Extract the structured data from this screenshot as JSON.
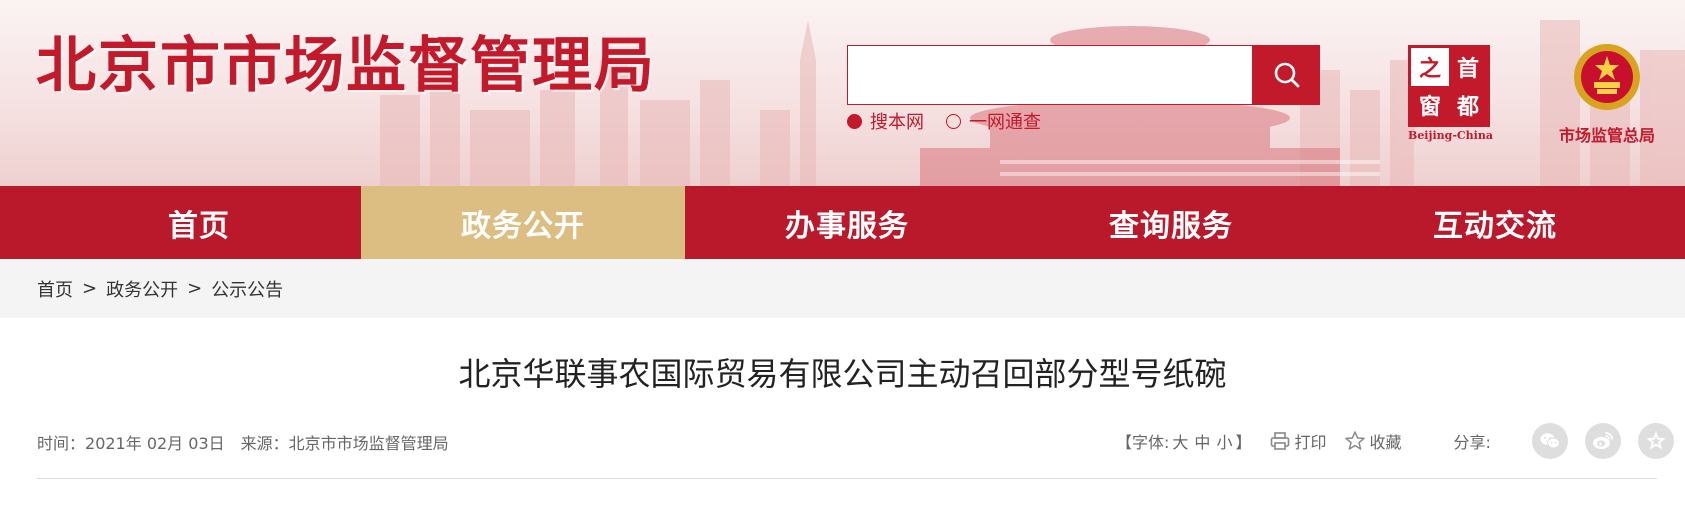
{
  "header": {
    "site_title": "北京市市场监督管理局",
    "search": {
      "placeholder": "",
      "options": [
        {
          "label": "搜本网",
          "selected": true
        },
        {
          "label": "一网通查",
          "selected": false
        }
      ],
      "button_icon": "search-icon"
    },
    "capital_logo": {
      "chars": [
        "之",
        "首",
        "窗",
        "都"
      ],
      "caption": "Beijing-China"
    },
    "samr_logo": {
      "icon": "national-emblem-icon",
      "caption": "市场监管总局"
    }
  },
  "nav": {
    "items": [
      {
        "label": "首页",
        "active": false
      },
      {
        "label": "政务公开",
        "active": true
      },
      {
        "label": "办事服务",
        "active": false
      },
      {
        "label": "查询服务",
        "active": false
      },
      {
        "label": "互动交流",
        "active": false
      }
    ]
  },
  "breadcrumb": {
    "items": [
      "首页",
      "政务公开",
      "公示公告"
    ],
    "separator": ">"
  },
  "article": {
    "title": "北京华联事农国际贸易有限公司主动召回部分型号纸碗",
    "time_label": "时间：",
    "time_value": "2021年 02月 03日",
    "source_label": "来源：",
    "source_value": "北京市市场监督管理局"
  },
  "tools": {
    "font_open": "【字体:",
    "font_sizes": [
      "大",
      "中",
      "小"
    ],
    "font_close": "】",
    "print_label": "打印",
    "favorite_label": "收藏",
    "share_label": "分享:",
    "share_icons": [
      "wechat-icon",
      "weibo-icon",
      "favorite-star-icon"
    ]
  },
  "colors": {
    "brand_red": "#b9192b",
    "nav_active_gold": "#dcbd82",
    "breadcrumb_bg": "#f4f4f4"
  }
}
